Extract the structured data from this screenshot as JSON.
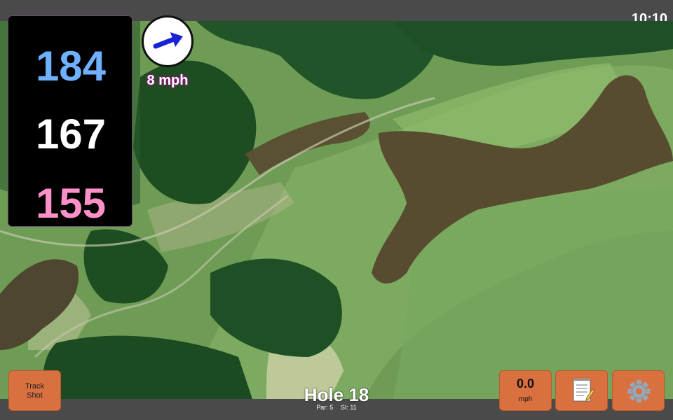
{
  "status": {
    "time": "10:10"
  },
  "distances": {
    "back": "184",
    "middle": "167",
    "front": "155"
  },
  "wind": {
    "speed_label": "8 mph",
    "direction_icon": "wind-arrow-icon"
  },
  "hole": {
    "title": "Hole 18",
    "par": "Par: 5",
    "si": "SI: 11"
  },
  "controls": {
    "track_shot_line1": "Track",
    "track_shot_line2": "Shot",
    "measured_speed": "0.0",
    "measured_unit": "mph",
    "notes_icon": "notepad-icon",
    "settings_icon": "gear-icon"
  },
  "colors": {
    "back": "#6fb1ff",
    "middle": "#ffffff",
    "front": "#ff8fc8",
    "button": "#d9703f"
  }
}
